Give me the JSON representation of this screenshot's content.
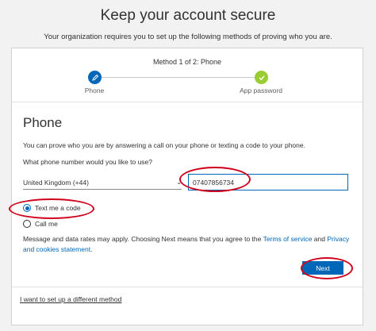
{
  "header": {
    "title": "Keep your account secure",
    "subtitle": "Your organization requires you to set up the following methods of proving who you are."
  },
  "stepper": {
    "label": "Method 1 of 2: Phone",
    "steps": [
      {
        "name": "Phone",
        "icon": "pencil-icon",
        "color": "#0067b8"
      },
      {
        "name": "App password",
        "icon": "checkmark-icon",
        "color": "#9acd32"
      }
    ]
  },
  "form": {
    "section_title": "Phone",
    "description": "You can prove who you are by answering a call on your phone or texting a code to your phone.",
    "question": "What phone number would you like to use?",
    "country_value": "United Kingdom (+44)",
    "phone_value": "07407856734",
    "options": [
      {
        "label": "Text me a code",
        "checked": true
      },
      {
        "label": "Call me",
        "checked": false
      }
    ],
    "legal_prefix": "Message and data rates may apply. Choosing Next means that you agree to the ",
    "terms_link": "Terms of service",
    "legal_and": " and ",
    "privacy_link": "Privacy and cookies statement",
    "legal_suffix": ".",
    "next_label": "Next",
    "alt_method_link": "I want to set up a different method"
  },
  "colors": {
    "accent": "#0067b8",
    "success": "#9acd32",
    "annotation": "#d0021b"
  }
}
